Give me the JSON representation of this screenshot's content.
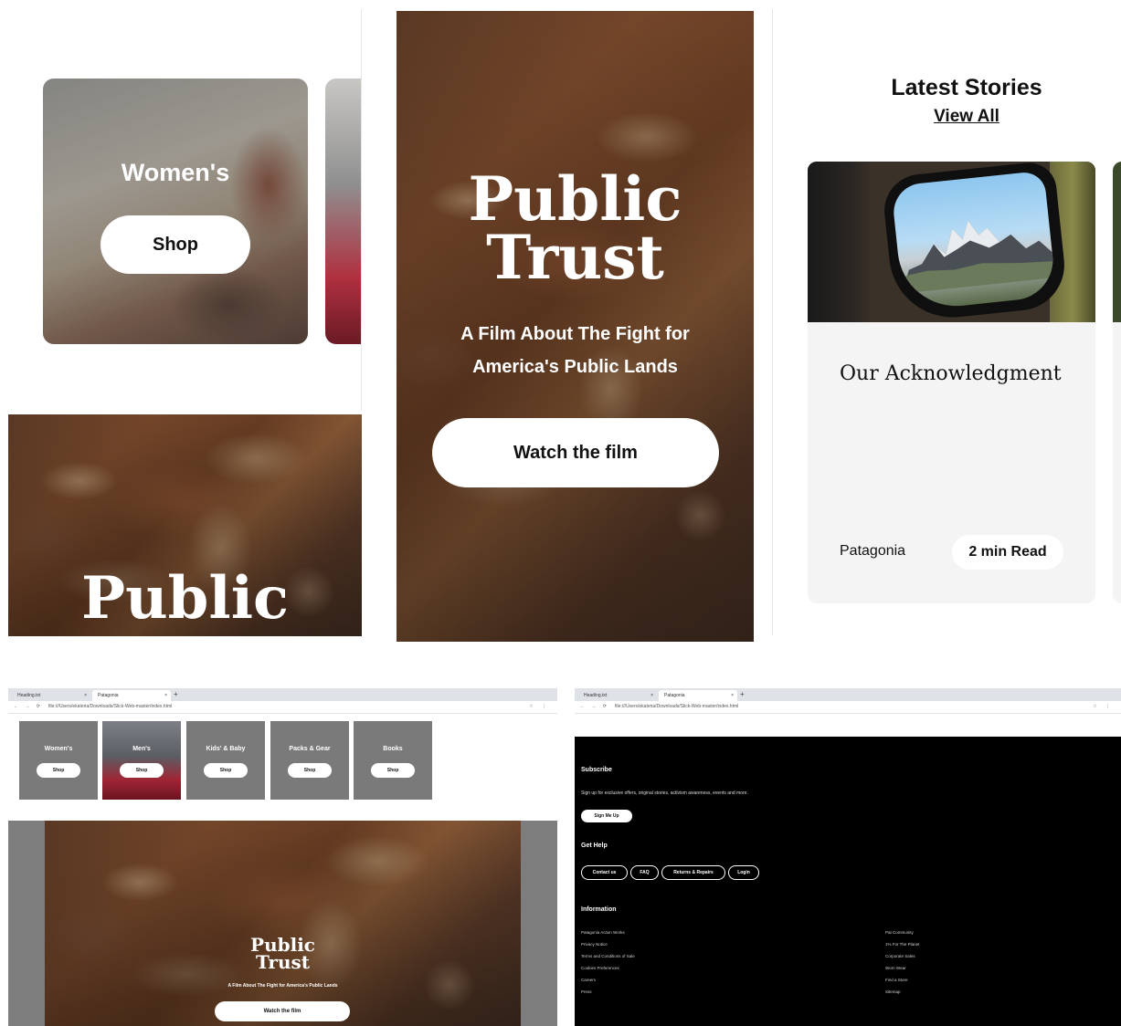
{
  "panel_top_left": {
    "category_women": "Women's",
    "shop_label": "Shop",
    "hero_title": "Public"
  },
  "panel_top_middle": {
    "title_line1": "Public",
    "title_line2": "Trust",
    "subtitle_line1": "A Film About The Fight for",
    "subtitle_line2": "America's Public Lands",
    "cta": "Watch the film"
  },
  "panel_top_right": {
    "heading": "Latest Stories",
    "view_all": "View All",
    "story": {
      "title": "Our Acknowledgment",
      "author": "Patagonia",
      "read_time": "2 min Read"
    }
  },
  "browser_left": {
    "tabs": [
      "Heading.txt",
      "Patagonia"
    ],
    "url": "file:///Users/ekateria/Downloads/Slick-Web-master/index.html",
    "categories": [
      {
        "label": "Women's",
        "button": "Shop"
      },
      {
        "label": "Men's",
        "button": "Shop"
      },
      {
        "label": "Kids' & Baby",
        "button": "Shop"
      },
      {
        "label": "Packs & Gear",
        "button": "Shop"
      },
      {
        "label": "Books",
        "button": "Shop"
      }
    ],
    "hero": {
      "title_line1": "Public",
      "title_line2": "Trust",
      "subtitle": "A Film About The Fight for America's Public Lands",
      "cta": "Watch the film"
    }
  },
  "browser_right": {
    "tabs": [
      "Heading.txt",
      "Patagonia"
    ],
    "url": "file:///Users/ekateria/Downloads/Slick-Web-master/index.html",
    "footer": {
      "subscribe_heading": "Subscribe",
      "subscribe_text": "Sign up for exclusive offers, original stories, activism awareness, events and more.",
      "signup_button": "Sign Me Up",
      "help_heading": "Get Help",
      "help_buttons": [
        "Contact us",
        "FAQ",
        "Returns & Repairs",
        "Login"
      ],
      "info_heading": "Information",
      "info_left": [
        "Patagonia Action Works",
        "Privacy Notice",
        "Terms and Conditions of Sale",
        "Cookies Preferences",
        "Careers",
        "Press"
      ],
      "info_right": [
        "Pat Community",
        "1% For The Planet",
        "Corporate Sales",
        "Worn Wear",
        "Find a Store",
        "Sitemap"
      ]
    }
  }
}
